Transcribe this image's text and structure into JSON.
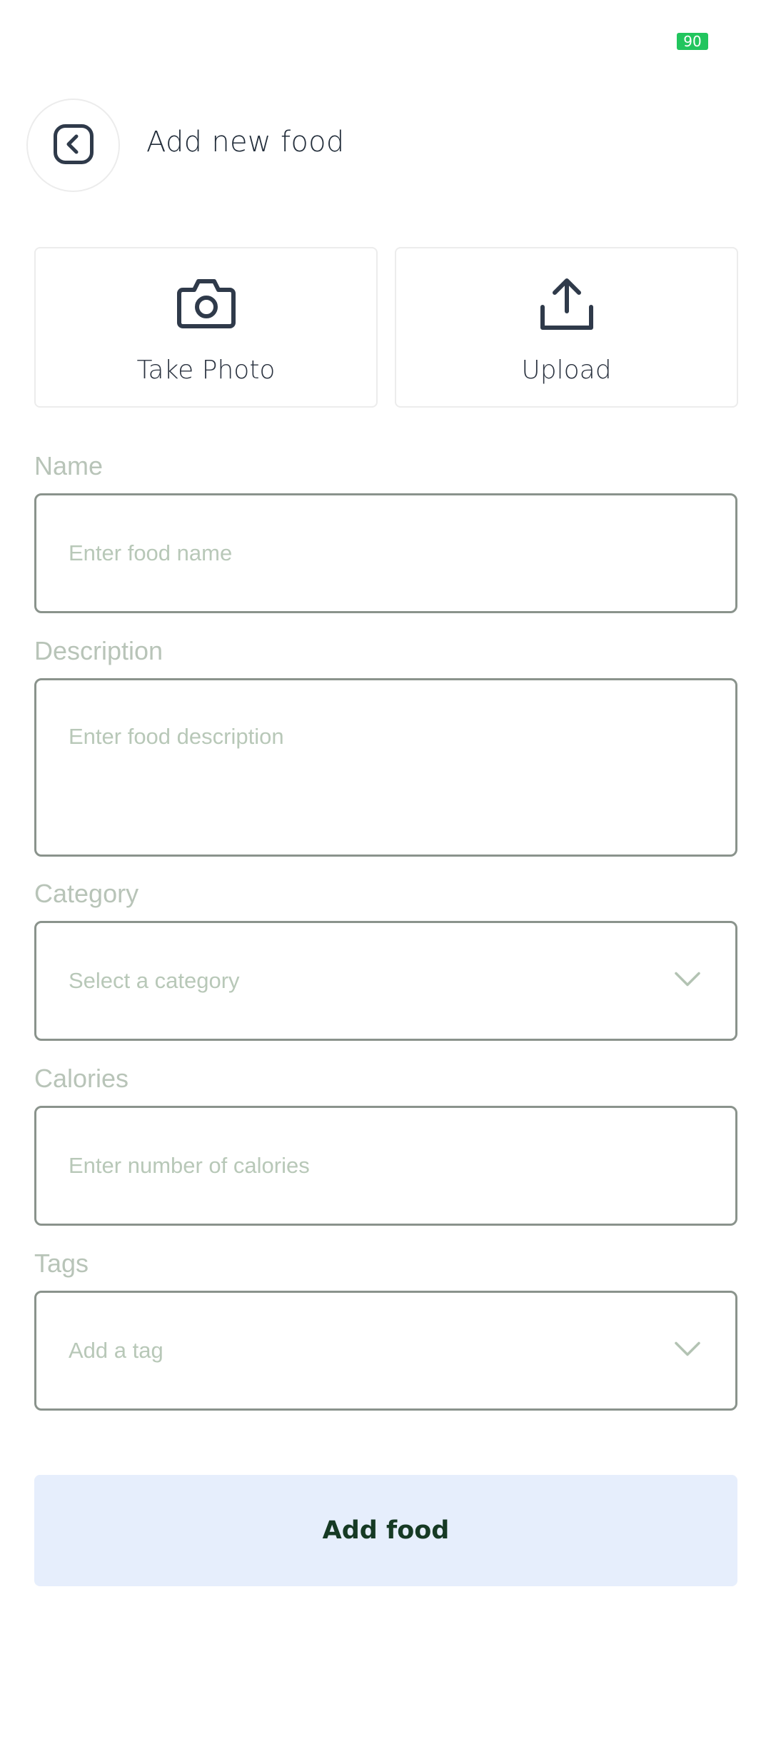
{
  "status_bar": {
    "battery_level": "90"
  },
  "header": {
    "title": "Add new food",
    "back_icon": "chevron-left-square-icon"
  },
  "media": {
    "take_photo_label": "Take Photo",
    "upload_label": "Upload",
    "camera_icon": "camera-icon",
    "upload_icon": "upload-icon"
  },
  "form": {
    "name": {
      "label": "Name",
      "placeholder": "Enter food name",
      "value": ""
    },
    "description": {
      "label": "Description",
      "placeholder": "Enter food description",
      "value": ""
    },
    "category": {
      "label": "Category",
      "placeholder": "Select a category",
      "selected": ""
    },
    "calories": {
      "label": "Calories",
      "placeholder": "Enter number of calories",
      "value": ""
    },
    "tags": {
      "label": "Tags",
      "placeholder": "Add a tag",
      "selected": ""
    }
  },
  "submit_label": "Add food",
  "colors": {
    "battery": "#22c55e",
    "icon_dark": "#2f3a4a",
    "label_muted": "#b8c4b8",
    "field_border": "#8a938c",
    "button_bg": "#e6eefc",
    "button_text": "#163a24"
  }
}
